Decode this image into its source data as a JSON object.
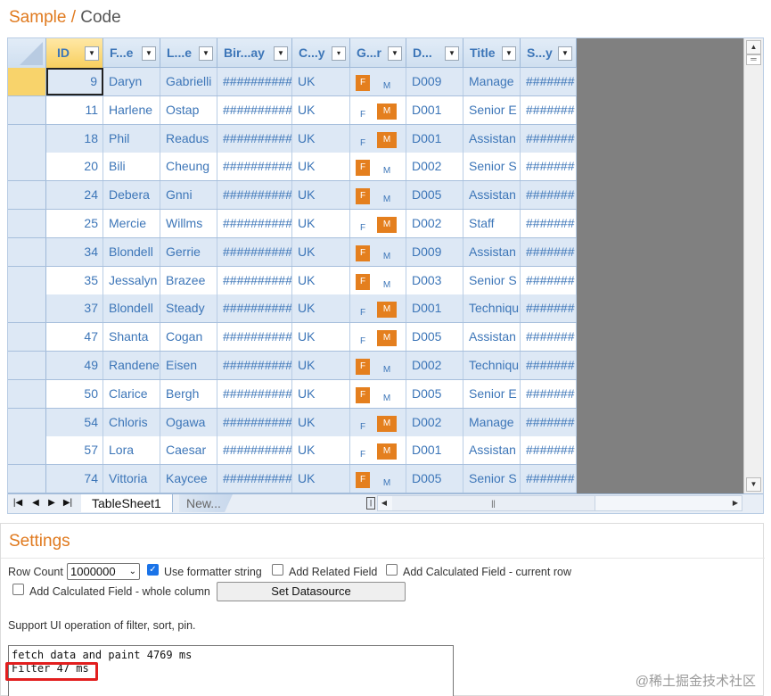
{
  "title": {
    "sample": "Sample",
    "separator": "/",
    "code": "Code"
  },
  "grid": {
    "columns": [
      {
        "key": "id",
        "label": "ID"
      },
      {
        "key": "first",
        "label": "F...e"
      },
      {
        "key": "last",
        "label": "L...e"
      },
      {
        "key": "birthday",
        "label": "Bir...ay"
      },
      {
        "key": "country",
        "label": "C...y"
      },
      {
        "key": "gender",
        "label": "G...r"
      },
      {
        "key": "dept",
        "label": "D..."
      },
      {
        "key": "title",
        "label": "Title"
      },
      {
        "key": "salary",
        "label": "S...y"
      }
    ],
    "rows": [
      {
        "id": "9",
        "first": "Daryn",
        "last": "Gabrielli",
        "birthday": "##########",
        "country": "UK",
        "gender": "F",
        "dept": "D009",
        "title": "Manage",
        "salary": "#######"
      },
      {
        "id": "11",
        "first": "Harlene",
        "last": "Ostap",
        "birthday": "##########",
        "country": "UK",
        "gender": "M",
        "dept": "D001",
        "title": "Senior E",
        "salary": "#######"
      },
      {
        "id": "18",
        "first": "Phil",
        "last": "Readus",
        "birthday": "##########",
        "country": "UK",
        "gender": "M",
        "dept": "D001",
        "title": "Assistan",
        "salary": "#######"
      },
      {
        "id": "20",
        "first": "Bili",
        "last": "Cheung",
        "birthday": "##########",
        "country": "UK",
        "gender": "F",
        "dept": "D002",
        "title": "Senior S",
        "salary": "#######"
      },
      {
        "id": "24",
        "first": "Debera",
        "last": "Gnni",
        "birthday": "##########",
        "country": "UK",
        "gender": "F",
        "dept": "D005",
        "title": "Assistan",
        "salary": "#######"
      },
      {
        "id": "25",
        "first": "Mercie",
        "last": "Willms",
        "birthday": "##########",
        "country": "UK",
        "gender": "M",
        "dept": "D002",
        "title": "Staff",
        "salary": "#######"
      },
      {
        "id": "34",
        "first": "Blondell",
        "last": "Gerrie",
        "birthday": "##########",
        "country": "UK",
        "gender": "F",
        "dept": "D009",
        "title": "Assistan",
        "salary": "#######"
      },
      {
        "id": "35",
        "first": "Jessalyn",
        "last": "Brazee",
        "birthday": "##########",
        "country": "UK",
        "gender": "F",
        "dept": "D003",
        "title": "Senior S",
        "salary": "#######"
      },
      {
        "id": "37",
        "first": "Blondell",
        "last": "Steady",
        "birthday": "##########",
        "country": "UK",
        "gender": "M",
        "dept": "D001",
        "title": "Techniqu",
        "salary": "#######"
      },
      {
        "id": "47",
        "first": "Shanta",
        "last": "Cogan",
        "birthday": "##########",
        "country": "UK",
        "gender": "M",
        "dept": "D005",
        "title": "Assistan",
        "salary": "#######"
      },
      {
        "id": "49",
        "first": "Randene",
        "last": "Eisen",
        "birthday": "##########",
        "country": "UK",
        "gender": "F",
        "dept": "D002",
        "title": "Techniqu",
        "salary": "#######"
      },
      {
        "id": "50",
        "first": "Clarice",
        "last": "Bergh",
        "birthday": "##########",
        "country": "UK",
        "gender": "F",
        "dept": "D005",
        "title": "Senior E",
        "salary": "#######"
      },
      {
        "id": "54",
        "first": "Chloris",
        "last": "Ogawa",
        "birthday": "##########",
        "country": "UK",
        "gender": "M",
        "dept": "D002",
        "title": "Manage",
        "salary": "#######"
      },
      {
        "id": "57",
        "first": "Lora",
        "last": "Caesar",
        "birthday": "##########",
        "country": "UK",
        "gender": "M",
        "dept": "D001",
        "title": "Assistan",
        "salary": "#######"
      },
      {
        "id": "74",
        "first": "Vittoria",
        "last": "Kaycee",
        "birthday": "##########",
        "country": "UK",
        "gender": "F",
        "dept": "D005",
        "title": "Senior S",
        "salary": "#######"
      }
    ],
    "gender_labels": {
      "female": "F",
      "male": "M"
    }
  },
  "tabs": {
    "active": "TableSheet1",
    "new": "New..."
  },
  "nav_icons": [
    "first-icon",
    "prev-icon",
    "next-icon",
    "last-icon"
  ],
  "settings": {
    "heading": "Settings",
    "row_count_label": "Row Count",
    "row_count_value": "1000000",
    "use_formatter_label": "Use formatter string",
    "use_formatter_checked": true,
    "add_related_label": "Add Related Field",
    "add_related_checked": false,
    "add_calc_row_label": "Add Calculated Field - current row",
    "add_calc_row_checked": false,
    "add_calc_col_label": "Add Calculated Field - whole column",
    "add_calc_col_checked": false,
    "set_datasource_label": "Set Datasource",
    "support_text": "Support UI operation of filter, sort, pin.",
    "log_lines": [
      "fetch data and paint 4769 ms",
      "Filter 47 ms"
    ]
  },
  "watermark": "@稀土掘金技术社区",
  "colors": {
    "accent": "#e07a1f",
    "header_blue": "#3d76b8",
    "highlight_red": "#e21e1e",
    "selection_yellow": "#f8d36b"
  }
}
